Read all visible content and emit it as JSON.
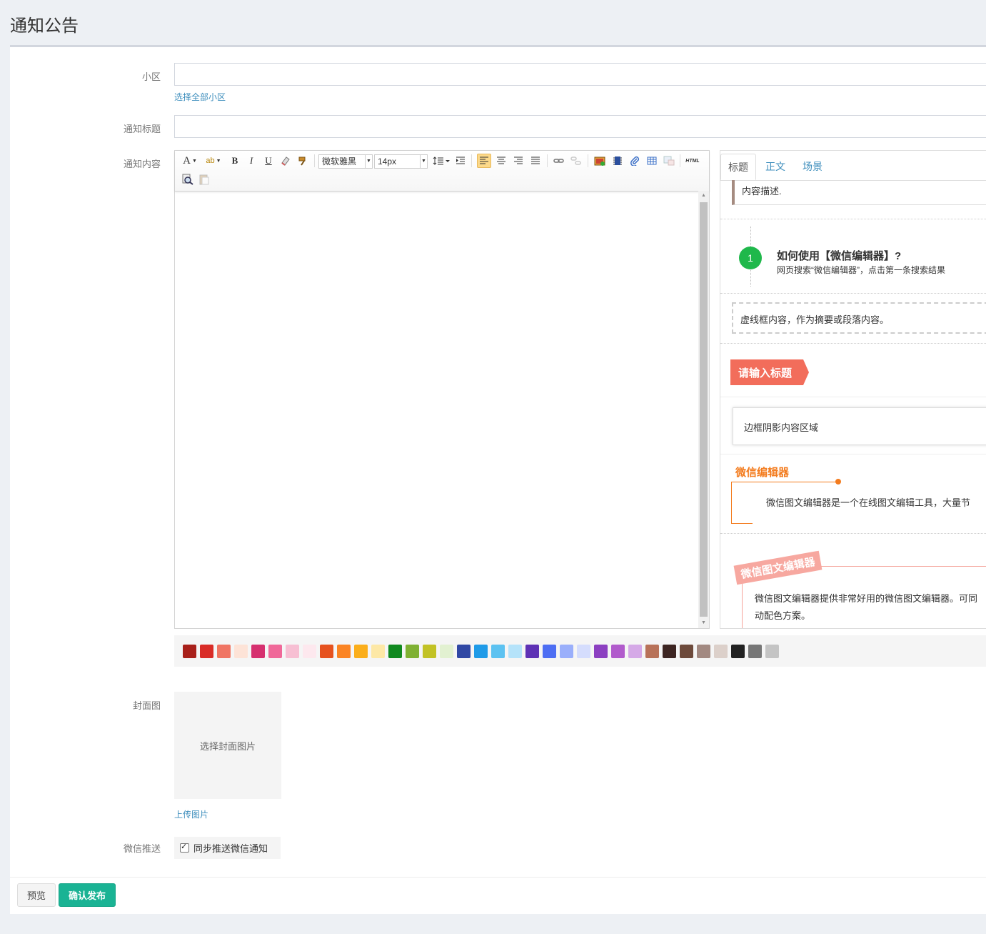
{
  "page": {
    "title": "通知公告"
  },
  "form": {
    "community_label": "小区",
    "select_all_link": "选择全部小区",
    "title_label": "通知标题",
    "content_label": "通知内容",
    "cover_label": "封面图",
    "cover_placeholder": "选择封面图片",
    "upload_link": "上传图片",
    "wechat_label": "微信推送",
    "sync_label": "同步推送微信通知"
  },
  "editor": {
    "font_family": "微软雅黑",
    "font_size": "14px",
    "html_label": "HTML"
  },
  "panel": {
    "tabs": [
      "标题",
      "正文",
      "场景"
    ],
    "items": {
      "desc_text": "内容描述.",
      "step_number": "1",
      "step_title": "如何使用【微信编辑器】?",
      "step_sub": "网页搜索“微信编辑器”，点击第一条搜索结果",
      "dashed_text": "虚线框内容，作为摘要或段落内容。",
      "ribbon_title": "请输入标题",
      "shadow_box_text": "边框阴影内容区域",
      "orange_title": "微信编辑器",
      "orange_body": "微信图文编辑器是一个在线图文编辑工具，大量节",
      "tag_title": "微信图文编辑器",
      "tag_body_1": "微信图文编辑器提供非常好用的微信图文编辑器。可同",
      "tag_body_2": "动配色方案。"
    }
  },
  "palette": [
    "#a8201a",
    "#d92c27",
    "#f07564",
    "#fde3d7",
    "#d6306f",
    "#f06899",
    "#f7bfd3",
    "#fde8ee",
    "#e6521f",
    "#fb8424",
    "#fbae1b",
    "#fde8a6",
    "#10891f",
    "#7fb133",
    "#c2c225",
    "#e2f1d1",
    "#3048a4",
    "#1f9be8",
    "#5cc2f1",
    "#b5e3fa",
    "#5e32b5",
    "#4d6ef3",
    "#9aaffb",
    "#d5ddfd",
    "#8c40c1",
    "#b15bcc",
    "#d5a9e7",
    "#b87259",
    "#3d2522",
    "#6d4a3b",
    "#a28981",
    "#dcd0ca",
    "#222222",
    "#777777",
    "#c4c4c4"
  ],
  "buttons": {
    "preview": "预览",
    "publish": "确认发布"
  }
}
